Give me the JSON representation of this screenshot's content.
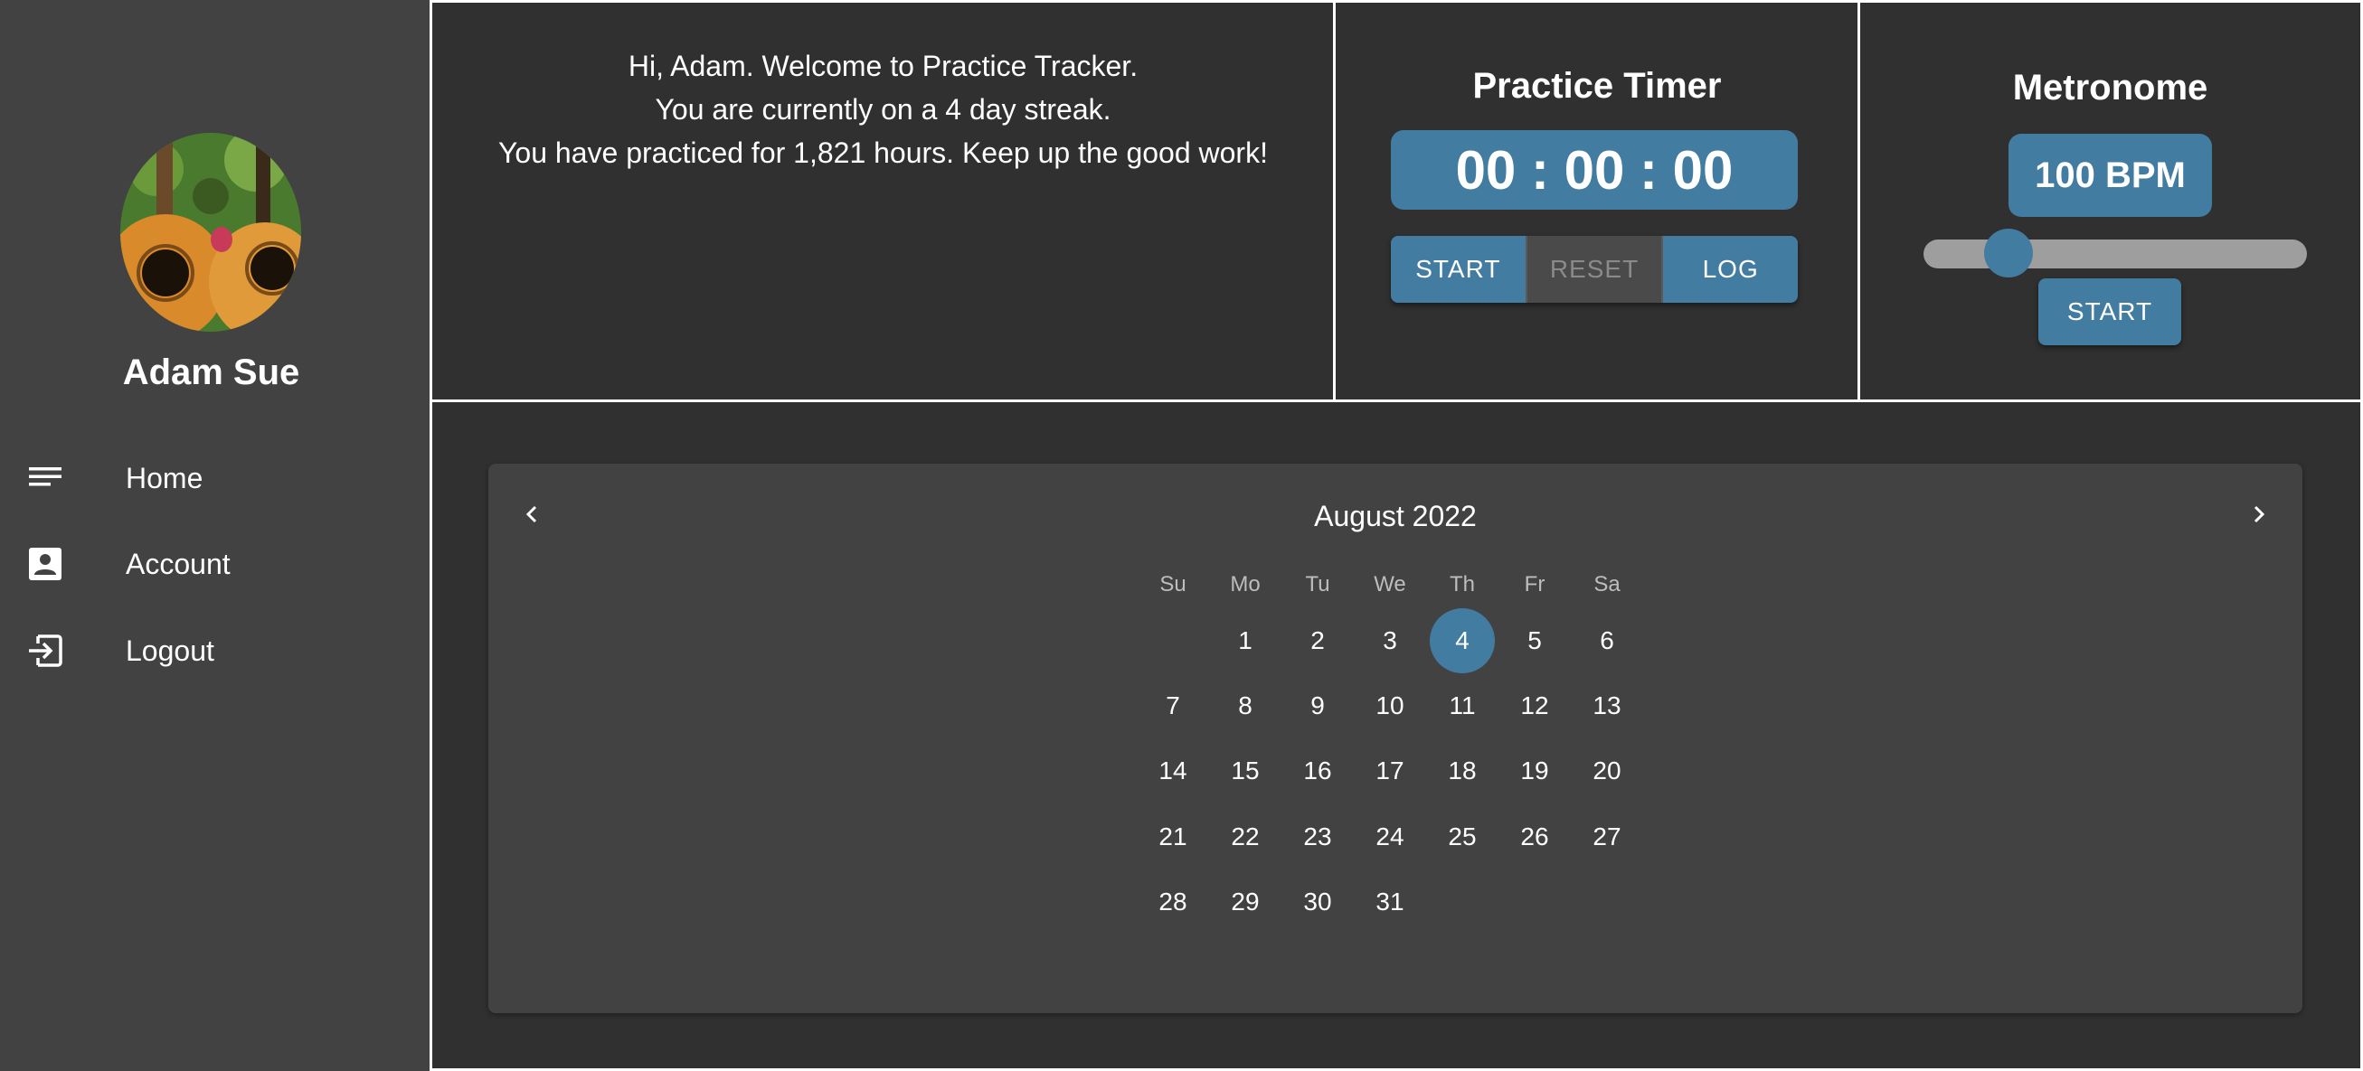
{
  "sidebar": {
    "username": "Adam Sue",
    "items": [
      {
        "label": "Home",
        "icon": "menu-lines-icon"
      },
      {
        "label": "Account",
        "icon": "account-box-icon"
      },
      {
        "label": "Logout",
        "icon": "logout-icon"
      }
    ]
  },
  "welcome": {
    "line1": "Hi, Adam. Welcome to Practice Tracker.",
    "line2": "You are currently on a 4 day streak.",
    "line3": "You have practiced for 1,821 hours. Keep up the good work!"
  },
  "timer": {
    "title": "Practice Timer",
    "display": "00 : 00 : 00",
    "start_label": "START",
    "reset_label": "RESET",
    "log_label": "LOG"
  },
  "metronome": {
    "title": "Metronome",
    "bpm_label": "100 BPM",
    "bpm_value": 100,
    "slider_fraction": 0.2,
    "start_label": "START"
  },
  "calendar": {
    "month_label": "August 2022",
    "weekdays": [
      "Su",
      "Mo",
      "Tu",
      "We",
      "Th",
      "Fr",
      "Sa"
    ],
    "first_weekday_index": 1,
    "days_in_month": 31,
    "selected_day": 4
  },
  "colors": {
    "accent": "#437ca1",
    "sidebar_bg": "#424242",
    "page_bg": "#303030",
    "card_bg": "#424242"
  }
}
